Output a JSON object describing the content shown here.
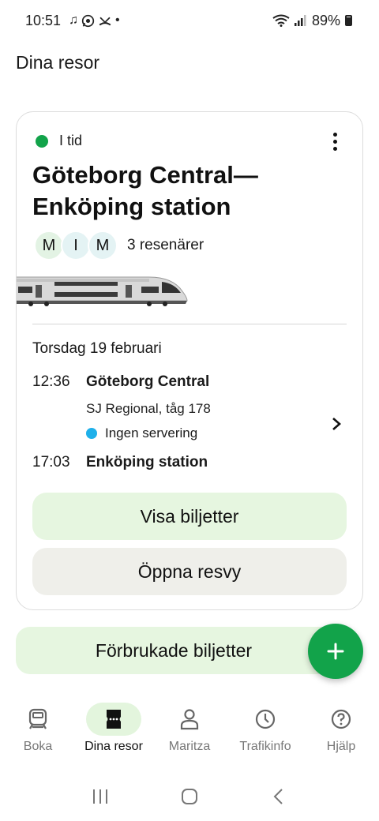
{
  "status_bar": {
    "time": "10:51",
    "notification_icons": [
      "music-note-icon",
      "whatsapp-icon",
      "missed-call-icon"
    ],
    "dot": "•",
    "battery": "89%"
  },
  "header": {
    "title": "Dina resor"
  },
  "trip": {
    "status": "I tid",
    "status_color": "#12a34a",
    "title": "Göteborg Central—Enköping station",
    "travelers": [
      "M",
      "I",
      "M"
    ],
    "traveler_count": "3 resenärer",
    "date": "Torsdag 19 februari",
    "departure": {
      "time": "12:36",
      "station": "Göteborg Central"
    },
    "service": "SJ Regional, tåg 178",
    "catering": "Ingen servering",
    "catering_color": "#1fb0ea",
    "arrival": {
      "time": "17:03",
      "station": "Enköping station"
    },
    "primary_button": "Visa biljetter",
    "secondary_button": "Öppna resvy"
  },
  "used_tickets_button": "Förbrukade biljetter",
  "bottom_nav": {
    "items": [
      {
        "label": "Boka",
        "icon": "train-icon"
      },
      {
        "label": "Dina resor",
        "icon": "ticket-icon",
        "active": true
      },
      {
        "label": "Maritza",
        "icon": "person-icon"
      },
      {
        "label": "Trafikinfo",
        "icon": "clock-icon"
      },
      {
        "label": "Hjälp",
        "icon": "help-icon"
      }
    ]
  },
  "colors": {
    "accent": "#12a34a",
    "button_green": "#e6f6e0",
    "button_grey": "#efefea"
  }
}
